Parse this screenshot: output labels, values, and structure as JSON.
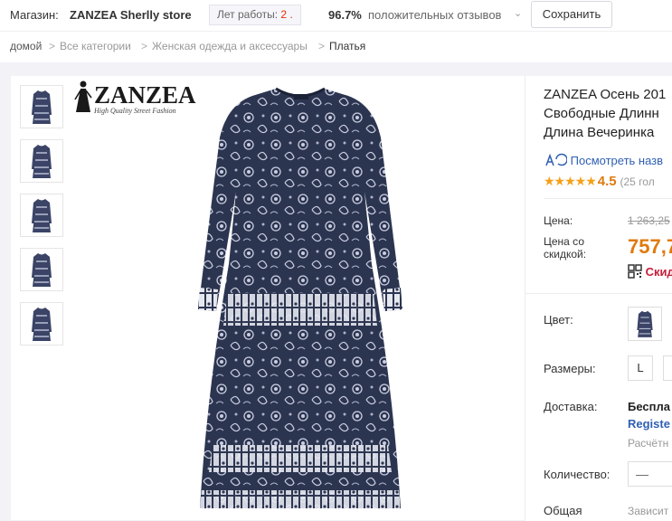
{
  "store_bar": {
    "store_label": "Магазин:",
    "store_name": "ZANZEA Sherlly store",
    "years_label": "Лет работы:",
    "years_value": "2",
    "positive_percent": "96.7%",
    "positive_label": "положительных отзывов",
    "save_button": "Сохранить"
  },
  "breadcrumb": {
    "home": "домой",
    "items": [
      "Все категории",
      "Женская одежда и аксессуары",
      "Платья"
    ],
    "separator": ">"
  },
  "gallery": {
    "thumbnail_count": 5,
    "logo_text": "ZANZEA",
    "logo_tagline": "High Quality Street Fashion"
  },
  "product": {
    "title_lines": [
      "ZANZEA Осень 201",
      "Свободные Длинн",
      "Длина Вечеринка"
    ],
    "compare_link": "Посмотреть назв",
    "rating_value": "4.5",
    "rating_count": "(25 гол",
    "price_label": "Цена:",
    "price_old": "1 263,25",
    "discount_label_1": "Цена со",
    "discount_label_2": "скидкой:",
    "price_new": "757,7",
    "coupon_text": "Скид"
  },
  "options": {
    "color_label": "Цвет:",
    "sizes_label": "Размеры:",
    "sizes": [
      "L",
      ""
    ],
    "shipping_label": "Доставка:",
    "shipping_line1": "Беспла",
    "shipping_line2": "Registe",
    "shipping_line3": "Расчётн",
    "quantity_label": "Количество:",
    "quantity_minus": "—",
    "total_label": "Общая",
    "total_note": "Зависит"
  },
  "colors": {
    "accent_orange": "#e07a0f",
    "link_blue": "#2f5fb3",
    "star": "#f6a01a",
    "years_red": "#e62e04",
    "dress_navy": "#2c3550"
  }
}
